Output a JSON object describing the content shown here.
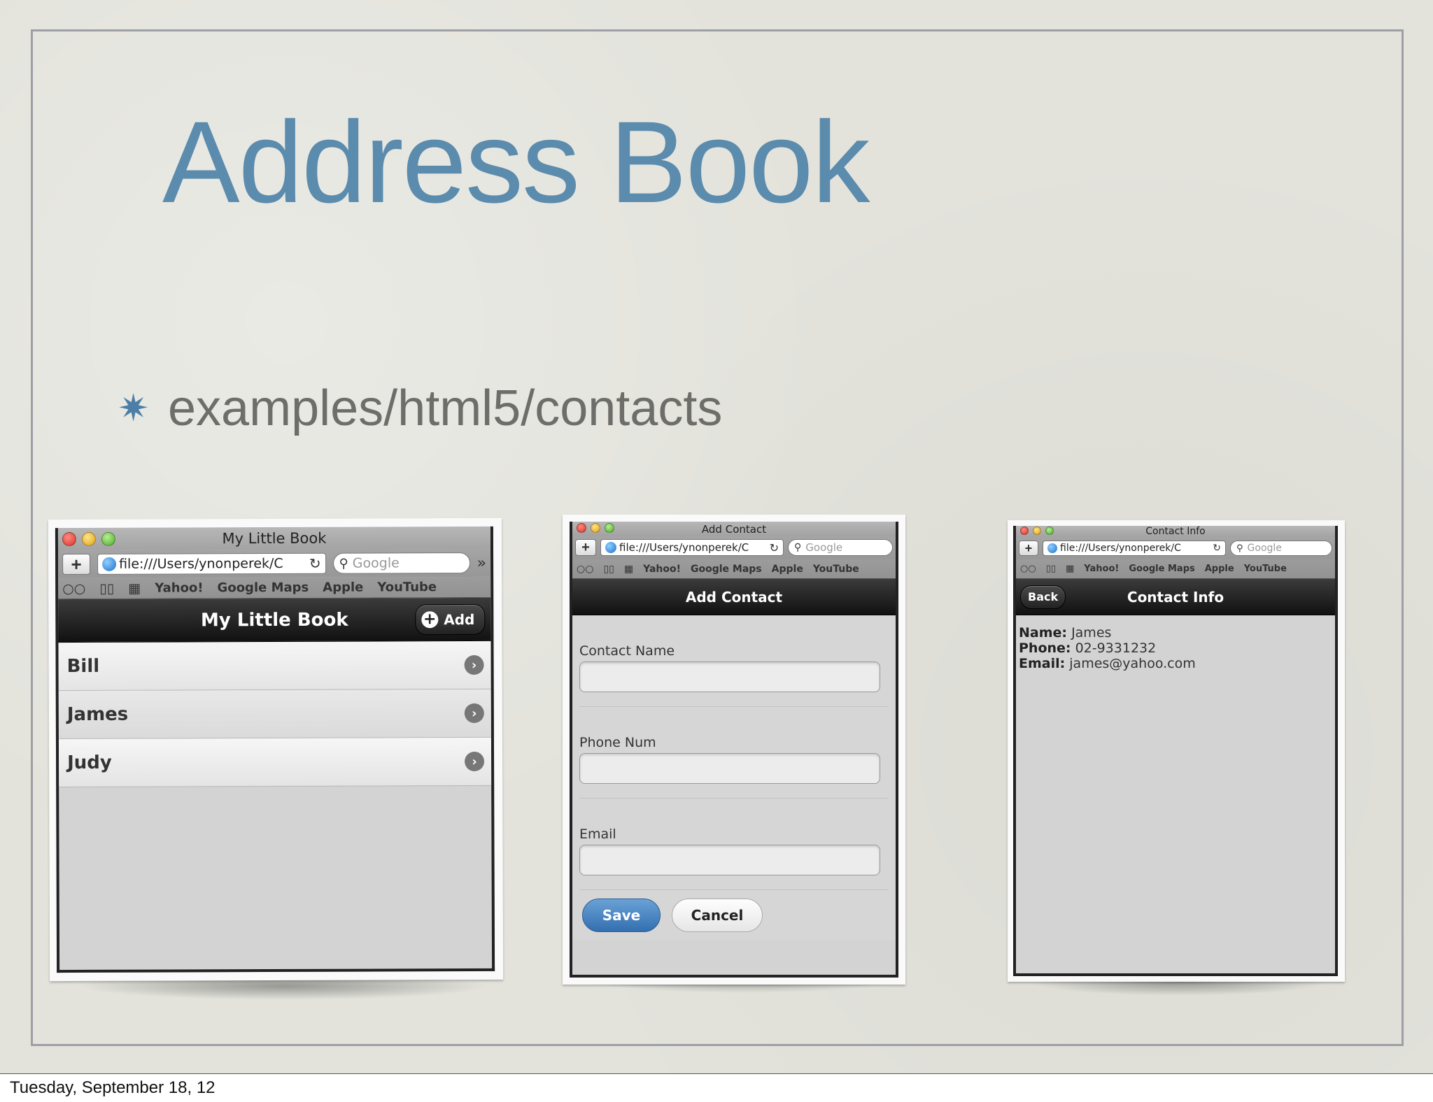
{
  "slide": {
    "title": "Address Book",
    "bullet": "examples/html5/contacts",
    "footer": "Tuesday, September 18, 12"
  },
  "browser": {
    "url": "file:///Users/ynonperek/C",
    "search_placeholder": "Google",
    "bookmarks": [
      "Yahoo!",
      "Google Maps",
      "Apple",
      "YouTube"
    ]
  },
  "screen_list": {
    "window_title": "My Little Book",
    "header_title": "My Little Book",
    "add_button": "Add",
    "contacts": [
      "Bill",
      "James",
      "Judy"
    ]
  },
  "screen_add": {
    "window_title": "Add Contact",
    "header_title": "Add Contact",
    "fields": [
      {
        "label": "Contact Name",
        "value": ""
      },
      {
        "label": "Phone Num",
        "value": ""
      },
      {
        "label": "Email",
        "value": ""
      }
    ],
    "save_label": "Save",
    "cancel_label": "Cancel"
  },
  "screen_info": {
    "window_title": "Contact Info",
    "header_title": "Contact Info",
    "back_label": "Back",
    "details": [
      {
        "key": "Name:",
        "value": "James"
      },
      {
        "key": "Phone:",
        "value": "02-9331232"
      },
      {
        "key": "Email:",
        "value": "james@yahoo.com"
      }
    ]
  },
  "colors": {
    "title": "#5b8bad",
    "bullet_text": "#6d6d6a",
    "save_button": "#4f8bc4"
  }
}
